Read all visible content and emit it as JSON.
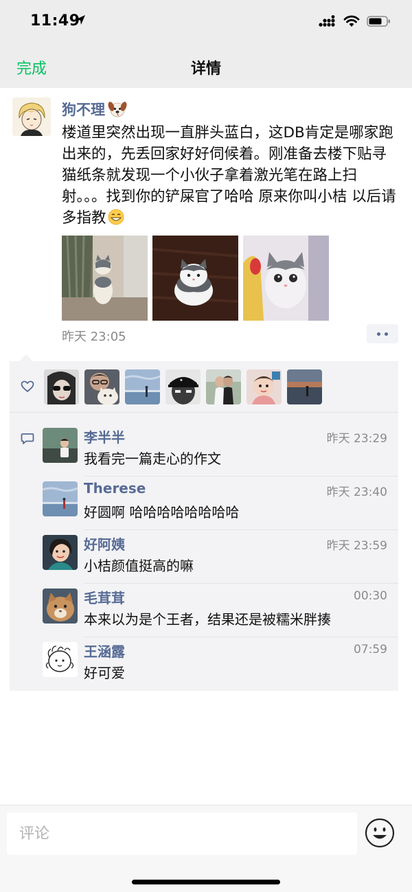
{
  "status_bar": {
    "time": "11:49"
  },
  "nav": {
    "done_label": "完成",
    "title": "详情"
  },
  "post": {
    "author": "狗不理",
    "author_emoji_icon": "dog-face-emoji",
    "text": "楼道里突然出现一直胖头蓝白，这DB肯定是哪家跑出来的，先丢回家好好伺候着。刚准备去楼下贴寻猫纸条就发现一个小伙子拿着激光笔在路上扫射。。。找到你的铲屎官了哈哈 原来你叫小桔 以后请多指教",
    "text_emoji_icon": "grinning-face-emoji",
    "time": "昨天 23:05",
    "photos": [
      "cat-by-curtain-photo",
      "cat-on-wood-floor-photo",
      "cat-with-teddy-photo"
    ]
  },
  "likes": {
    "icon": "heart-icon",
    "avatars": [
      "sunglasses-woman-avatar",
      "man-with-cat-avatar",
      "beach-blue-avatar",
      "black-white-cap-avatar",
      "couple-wedding-avatar",
      "baby-avatar",
      "sunset-silhouette-avatar"
    ]
  },
  "comments": [
    {
      "name": "李半半",
      "time": "昨天 23:29",
      "text": "我看完一篇走心的作文"
    },
    {
      "name": "Therese",
      "time": "昨天 23:40",
      "text": "好圆啊 哈哈哈哈哈哈哈哈"
    },
    {
      "name": "好阿姨",
      "time": "昨天 23:59",
      "text": "小桔颜值挺高的嘛"
    },
    {
      "name": "毛茸茸",
      "time": "00:30",
      "text": "本来以为是个王者，结果还是被糯米胖揍"
    },
    {
      "name": "王涵露",
      "time": "07:59",
      "text": "好可爱"
    }
  ],
  "comment_input": {
    "placeholder": "评论"
  },
  "colors": {
    "accent_green": "#07c160",
    "link_blue": "#576b95",
    "bar_gray": "#ededed"
  }
}
